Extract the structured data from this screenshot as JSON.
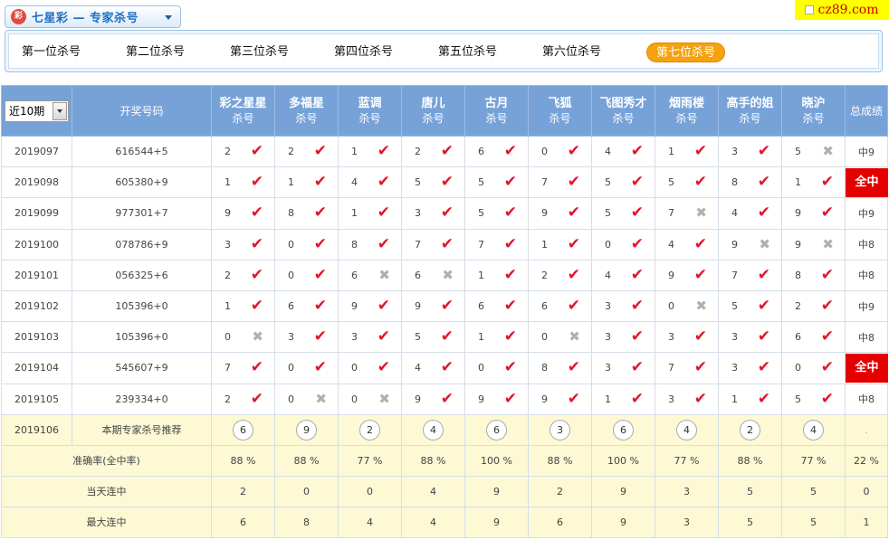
{
  "lottery_title": "七星彩 — 专家杀号",
  "logo_text": "彩",
  "site_badge": "cz89.com",
  "tabs": [
    "第一位杀号",
    "第二位杀号",
    "第三位杀号",
    "第四位杀号",
    "第五位杀号",
    "第六位杀号",
    "第七位杀号"
  ],
  "active_tab": 6,
  "period_select": "近10期",
  "headers": {
    "draw_number": "开奖号码",
    "kill_label": "杀号",
    "total": "总成绩",
    "experts": [
      "彩之星星",
      "多福星",
      "蓝调",
      "唐儿",
      "古月",
      "飞狐",
      "飞图秀才",
      "烟雨楼",
      "高手的姐",
      "晓沪"
    ]
  },
  "rows": [
    {
      "issue": "2019097",
      "draw": "616544+5",
      "cells": [
        [
          2,
          1
        ],
        [
          2,
          1
        ],
        [
          1,
          1
        ],
        [
          2,
          1
        ],
        [
          6,
          1
        ],
        [
          0,
          1
        ],
        [
          4,
          1
        ],
        [
          1,
          1
        ],
        [
          3,
          1
        ],
        [
          5,
          0
        ]
      ],
      "total": "中9",
      "allhit": false
    },
    {
      "issue": "2019098",
      "draw": "605380+9",
      "cells": [
        [
          1,
          1
        ],
        [
          1,
          1
        ],
        [
          4,
          1
        ],
        [
          5,
          1
        ],
        [
          5,
          1
        ],
        [
          7,
          1
        ],
        [
          5,
          1
        ],
        [
          5,
          1
        ],
        [
          8,
          1
        ],
        [
          1,
          1
        ]
      ],
      "total": "全中",
      "allhit": true
    },
    {
      "issue": "2019099",
      "draw": "977301+7",
      "cells": [
        [
          9,
          1
        ],
        [
          8,
          1
        ],
        [
          1,
          1
        ],
        [
          3,
          1
        ],
        [
          5,
          1
        ],
        [
          9,
          1
        ],
        [
          5,
          1
        ],
        [
          7,
          0
        ],
        [
          4,
          1
        ],
        [
          9,
          1
        ]
      ],
      "total": "中9",
      "allhit": false
    },
    {
      "issue": "2019100",
      "draw": "078786+9",
      "cells": [
        [
          3,
          1
        ],
        [
          0,
          1
        ],
        [
          8,
          1
        ],
        [
          7,
          1
        ],
        [
          7,
          1
        ],
        [
          1,
          1
        ],
        [
          0,
          1
        ],
        [
          4,
          1
        ],
        [
          9,
          0
        ],
        [
          9,
          0
        ]
      ],
      "total": "中8",
      "allhit": false
    },
    {
      "issue": "2019101",
      "draw": "056325+6",
      "cells": [
        [
          2,
          1
        ],
        [
          0,
          1
        ],
        [
          6,
          0
        ],
        [
          6,
          0
        ],
        [
          1,
          1
        ],
        [
          2,
          1
        ],
        [
          4,
          1
        ],
        [
          9,
          1
        ],
        [
          7,
          1
        ],
        [
          8,
          1
        ]
      ],
      "total": "中8",
      "allhit": false
    },
    {
      "issue": "2019102",
      "draw": "105396+0",
      "cells": [
        [
          1,
          1
        ],
        [
          6,
          1
        ],
        [
          9,
          1
        ],
        [
          9,
          1
        ],
        [
          6,
          1
        ],
        [
          6,
          1
        ],
        [
          3,
          1
        ],
        [
          0,
          0
        ],
        [
          5,
          1
        ],
        [
          2,
          1
        ]
      ],
      "total": "中9",
      "allhit": false
    },
    {
      "issue": "2019103",
      "draw": "105396+0",
      "cells": [
        [
          0,
          0
        ],
        [
          3,
          1
        ],
        [
          3,
          1
        ],
        [
          5,
          1
        ],
        [
          1,
          1
        ],
        [
          0,
          0
        ],
        [
          3,
          1
        ],
        [
          3,
          1
        ],
        [
          3,
          1
        ],
        [
          6,
          1
        ]
      ],
      "total": "中8",
      "allhit": false
    },
    {
      "issue": "2019104",
      "draw": "545607+9",
      "cells": [
        [
          7,
          1
        ],
        [
          0,
          1
        ],
        [
          0,
          1
        ],
        [
          4,
          1
        ],
        [
          0,
          1
        ],
        [
          8,
          1
        ],
        [
          3,
          1
        ],
        [
          7,
          1
        ],
        [
          3,
          1
        ],
        [
          0,
          1
        ]
      ],
      "total": "全中",
      "allhit": true
    },
    {
      "issue": "2019105",
      "draw": "239334+0",
      "cells": [
        [
          2,
          1
        ],
        [
          0,
          0
        ],
        [
          0,
          0
        ],
        [
          9,
          1
        ],
        [
          9,
          1
        ],
        [
          9,
          1
        ],
        [
          1,
          1
        ],
        [
          3,
          1
        ],
        [
          1,
          1
        ],
        [
          5,
          1
        ]
      ],
      "total": "中8",
      "allhit": false
    }
  ],
  "recommend": {
    "issue": "2019106",
    "label": "本期专家杀号推荐",
    "nums": [
      6,
      9,
      2,
      4,
      6,
      3,
      6,
      4,
      2,
      4
    ],
    "total": "."
  },
  "stats": [
    {
      "label": "准确率(全中率)",
      "vals": [
        "88 %",
        "88 %",
        "77 %",
        "88 %",
        "100 %",
        "88 %",
        "100 %",
        "77 %",
        "88 %",
        "77 %"
      ],
      "total": "22 %"
    },
    {
      "label": "当天连中",
      "vals": [
        "2",
        "0",
        "0",
        "4",
        "9",
        "2",
        "9",
        "3",
        "5",
        "5"
      ],
      "total": "0"
    },
    {
      "label": "最大连中",
      "vals": [
        "6",
        "8",
        "4",
        "4",
        "9",
        "6",
        "9",
        "3",
        "5",
        "5"
      ],
      "total": "1"
    }
  ],
  "colors": {
    "header_bg": "#76a2d8",
    "active_tab": "#f5a20e",
    "hit": "#e0152b",
    "miss": "#b0b0b0",
    "allhit_bg": "#e50000",
    "stat_bg": "#fcf9d4"
  }
}
